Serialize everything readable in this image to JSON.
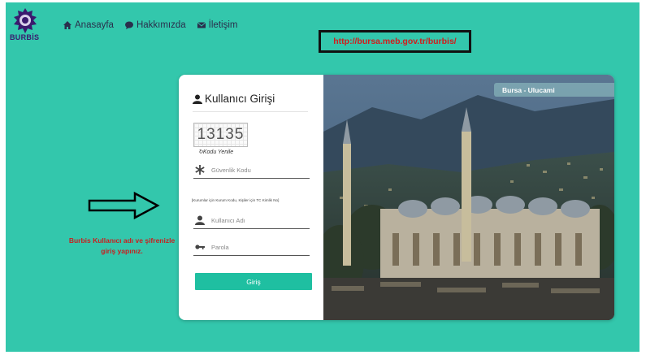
{
  "header": {
    "logo_text": "BURBİS",
    "nav": [
      {
        "label": "Anasayfa",
        "icon": "home-icon"
      },
      {
        "label": "Hakkımızda",
        "icon": "chat-icon"
      },
      {
        "label": "İletişim",
        "icon": "envelope-icon"
      }
    ],
    "url_annotation": "http://bursa.meb.gov.tr/burbis/"
  },
  "annotation": {
    "note": "Burbis Kullanıcı adı ve şifrenizle giriş yapınız."
  },
  "login": {
    "title": "Kullanıcı Girişi",
    "captcha_code": "13135",
    "refresh_label": "Kodu Yenile",
    "security_placeholder": "Güvenlik Kodu",
    "hint": "[Kurumlar için Kurum Kodu, Kişiler için TC Kimlik No]",
    "username_placeholder": "Kullanıcı Adı",
    "password_placeholder": "Parola",
    "submit_label": "Giriş"
  },
  "photo": {
    "label": "Bursa - Ulucami"
  },
  "colors": {
    "background": "#33c7ac",
    "button": "#1fbfa1",
    "annotation_red": "#d11c1c"
  }
}
